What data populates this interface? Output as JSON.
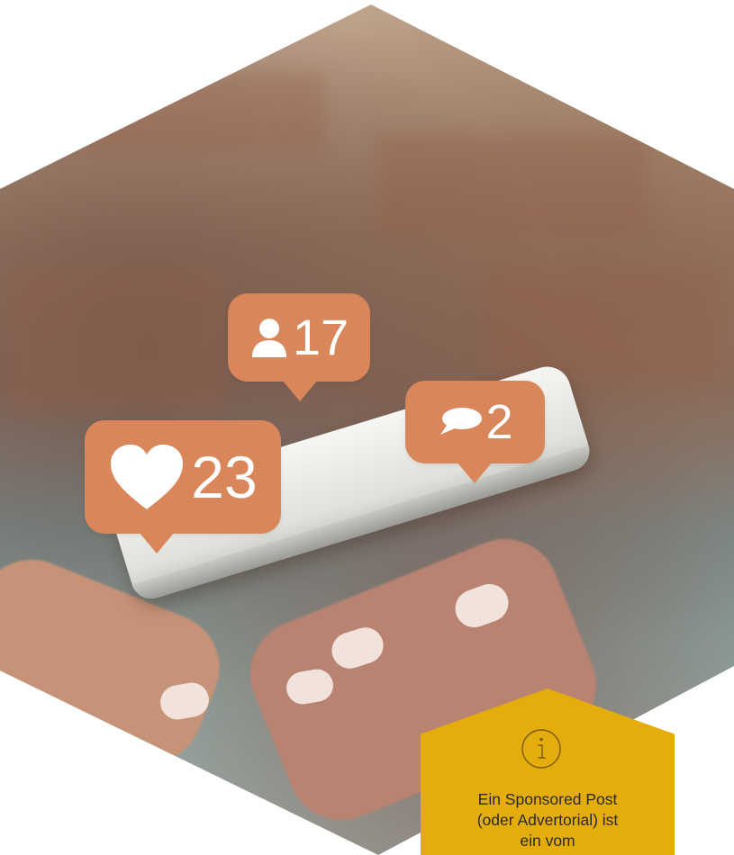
{
  "photo": {
    "counters": {
      "likes": {
        "icon": "heart-icon",
        "count": "23"
      },
      "followers": {
        "icon": "user-icon",
        "count": "17"
      },
      "comments": {
        "icon": "speech-bubble-icon",
        "count": "2"
      }
    },
    "bubble_color": "#d9875a"
  },
  "info_box": {
    "icon": "info-icon",
    "color": "#e5ad0b",
    "lines": [
      "Ein Sponsored Post",
      "(oder Advertorial) ist",
      "ein vom"
    ]
  }
}
